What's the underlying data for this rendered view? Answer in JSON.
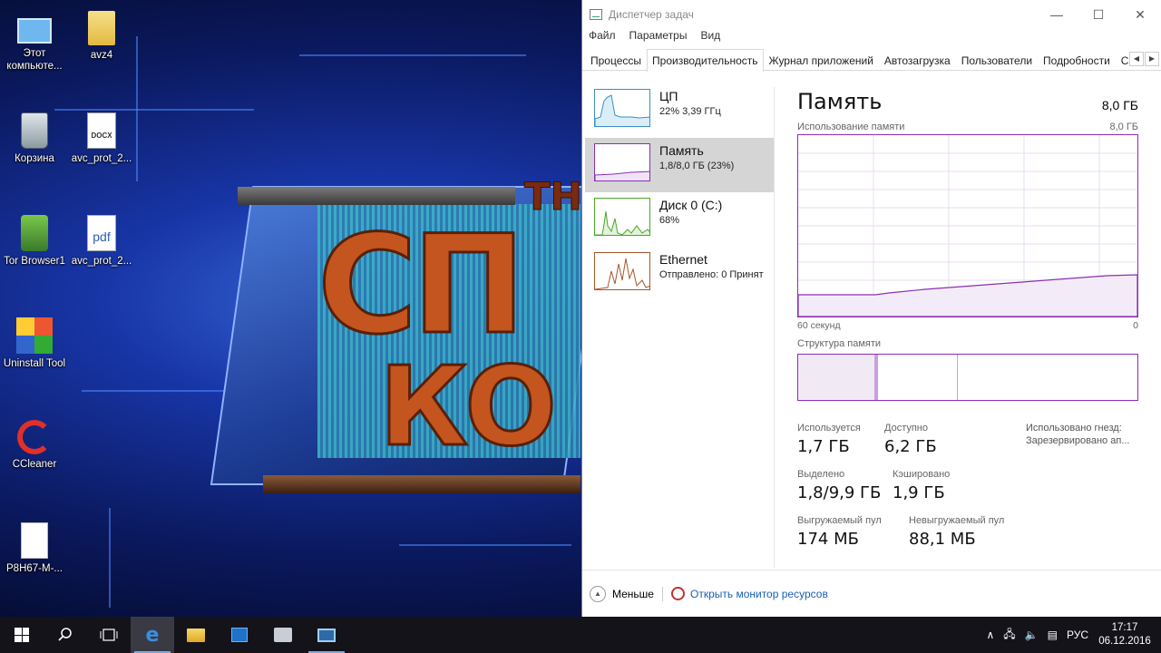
{
  "desktop": {
    "icons": [
      {
        "label": "Этот компьюте...",
        "icon": "computer-icon"
      },
      {
        "label": "avz4",
        "icon": "folder-icon"
      },
      {
        "label": "Корзина",
        "icon": "recycle-bin-icon"
      },
      {
        "label": "avc_prot_2...",
        "icon": "docx-file-icon",
        "badge": "DOCX"
      },
      {
        "label": "Tor Browser1",
        "icon": "tor-browser-icon"
      },
      {
        "label": "avc_prot_2...",
        "icon": "pdf-file-icon",
        "badge": "pdf"
      },
      {
        "label": "Uninstall Tool",
        "icon": "uninstall-tool-icon"
      },
      {
        "label": "CCleaner",
        "icon": "ccleaner-icon"
      },
      {
        "label": "P8H67-M-...",
        "icon": "file-icon"
      }
    ],
    "wallpaper_text": {
      "big": "СП",
      "small": "КО",
      "corner": "ТН"
    }
  },
  "task_manager": {
    "title": "Диспетчер задач",
    "window_buttons": {
      "minimize": "—",
      "maximize": "☐",
      "close": "✕"
    },
    "menu": [
      "Файл",
      "Параметры",
      "Вид"
    ],
    "tabs": [
      "Процессы",
      "Производительность",
      "Журнал приложений",
      "Автозагрузка",
      "Пользователи",
      "Подробности",
      "С"
    ],
    "active_tab": "Производительность",
    "resources": [
      {
        "name": "ЦП",
        "detail": "22%  3,39 ГГц",
        "color": "#3a8fc4"
      },
      {
        "name": "Память",
        "detail": "1,8/8,0 ГБ (23%)",
        "color": "#8b2fb5"
      },
      {
        "name": "Диск 0 (C:)",
        "detail": "68%",
        "color": "#4ca52a"
      },
      {
        "name": "Ethernet",
        "detail": "Отправлено: 0 Принят",
        "color": "#a5562a"
      }
    ],
    "memory": {
      "title": "Память",
      "total": "8,0 ГБ",
      "usage_label": "Использование памяти",
      "usage_max": "8,0 ГБ",
      "axis_left": "60 секунд",
      "axis_right": "0",
      "structure_label": "Структура памяти",
      "stats": {
        "in_use": {
          "label": "Используется",
          "value": "1,7 ГБ"
        },
        "available": {
          "label": "Доступно",
          "value": "6,2 ГБ"
        },
        "committed": {
          "label": "Выделено",
          "value": "1,8/9,9 ГБ"
        },
        "cached": {
          "label": "Кэшировано",
          "value": "1,9 ГБ"
        },
        "paged_pool": {
          "label": "Выгружаемый пул",
          "value": "174 МБ"
        },
        "nonpaged_pool": {
          "label": "Невыгружаемый пул",
          "value": "88,1 МБ"
        }
      },
      "side": {
        "slots_label": "Использовано гнезд:",
        "reserved_label": "Зарезервировано ап..."
      }
    },
    "footer": {
      "less": "Меньше",
      "resource_monitor": "Открыть монитор ресурсов"
    }
  },
  "taskbar": {
    "language": "РУС",
    "time": "17:17",
    "date": "06.12.2016"
  }
}
